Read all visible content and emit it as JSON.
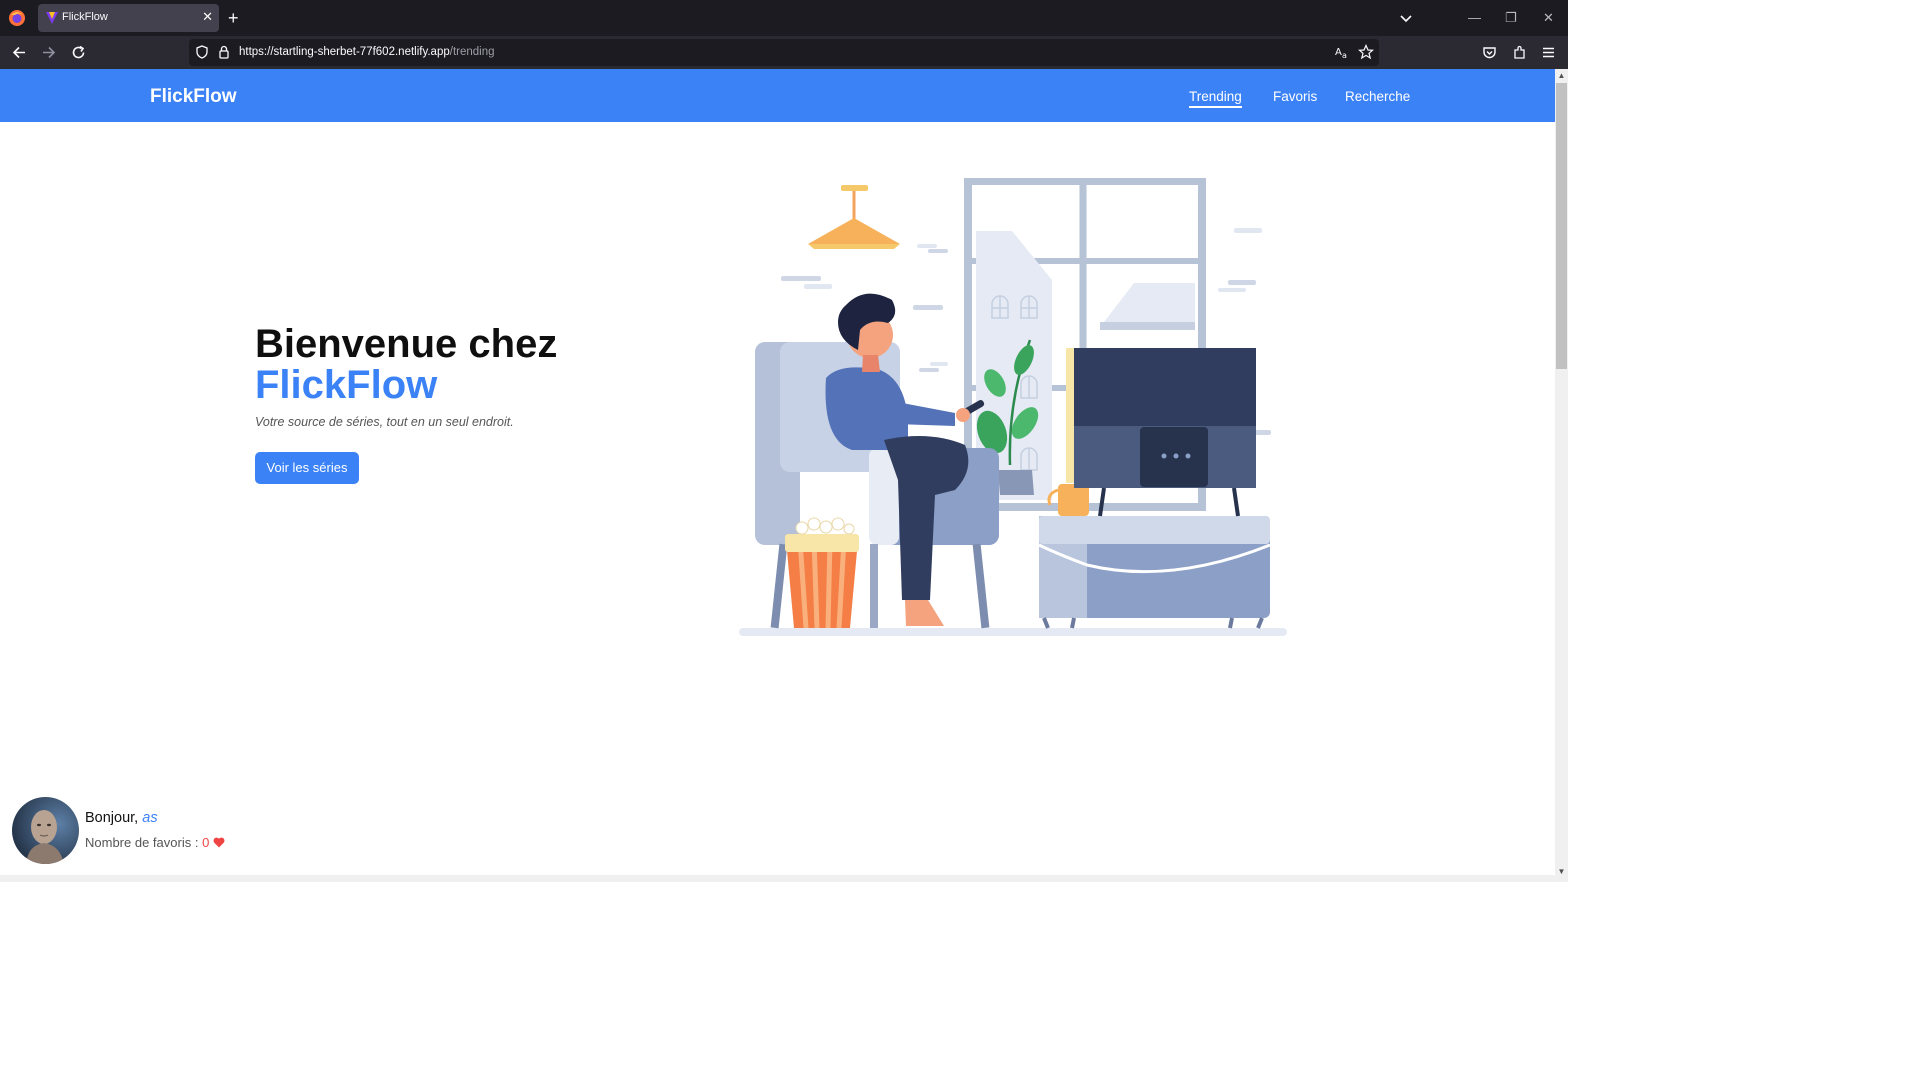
{
  "browser": {
    "tab_title": "FlickFlow",
    "url_host": "https://startling-sherbet-77f602.netlify.app",
    "url_path": "/trending"
  },
  "site": {
    "brand": "FlickFlow",
    "nav": [
      {
        "label": "Trending",
        "active": true
      },
      {
        "label": "Favoris",
        "active": false
      },
      {
        "label": "Recherche",
        "active": false
      }
    ]
  },
  "hero": {
    "title_line1": "Bienvenue chez",
    "title_line2": "FlickFlow",
    "subtitle": "Votre source de séries, tout en un seul endroit.",
    "cta_label": "Voir les séries"
  },
  "profile": {
    "greeting": "Bonjour,",
    "username": "as",
    "favorites_label": "Nombre de favoris :",
    "favorites_count": "0"
  },
  "colors": {
    "accent": "#3b82f6",
    "heart": "#ef4444"
  }
}
